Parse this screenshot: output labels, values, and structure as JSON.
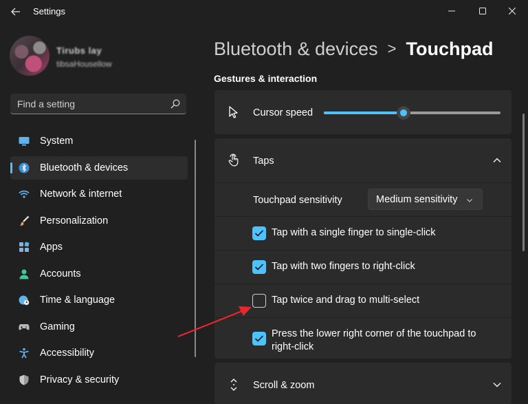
{
  "window": {
    "title": "Settings",
    "back_icon": "back-arrow-icon",
    "controls": [
      "minimize-icon",
      "maximize-icon",
      "close-icon"
    ]
  },
  "user": {
    "name": "Tirubs lay",
    "email": "tibsaHousellow"
  },
  "search": {
    "placeholder": "Find a setting",
    "icon": "search-icon"
  },
  "sidebar": {
    "items": [
      {
        "label": "System",
        "icon": "system-monitor-icon",
        "selected": false
      },
      {
        "label": "Bluetooth & devices",
        "icon": "bluetooth-icon",
        "selected": true
      },
      {
        "label": "Network & internet",
        "icon": "wifi-icon",
        "selected": false
      },
      {
        "label": "Personalization",
        "icon": "paintbrush-icon",
        "selected": false
      },
      {
        "label": "Apps",
        "icon": "apps-grid-icon",
        "selected": false
      },
      {
        "label": "Accounts",
        "icon": "person-icon",
        "selected": false
      },
      {
        "label": "Time & language",
        "icon": "globe-clock-icon",
        "selected": false
      },
      {
        "label": "Gaming",
        "icon": "gamepad-icon",
        "selected": false
      },
      {
        "label": "Accessibility",
        "icon": "accessibility-icon",
        "selected": false
      },
      {
        "label": "Privacy & security",
        "icon": "shield-icon",
        "selected": false
      }
    ]
  },
  "breadcrumb": {
    "parent": "Bluetooth & devices",
    "separator": ">",
    "current": "Touchpad"
  },
  "section": {
    "title": "Gestures & interaction"
  },
  "cursor_speed": {
    "label": "Cursor speed",
    "icon": "cursor-arrow-icon",
    "value_fraction": 0.45
  },
  "taps": {
    "label": "Taps",
    "icon": "touch-hand-icon",
    "expanded": true,
    "sensitivity": {
      "label": "Touchpad sensitivity",
      "value": "Medium sensitivity"
    },
    "options": [
      {
        "label": "Tap with a single finger to single-click",
        "checked": true
      },
      {
        "label": "Tap with two fingers to right-click",
        "checked": true
      },
      {
        "label": "Tap twice and drag to multi-select",
        "checked": false
      },
      {
        "label_line1": "Press the lower right corner of the touchpad to",
        "label_line2": "right-click",
        "checked": true
      }
    ]
  },
  "scroll_zoom": {
    "label": "Scroll & zoom",
    "icon": "scroll-arrows-icon",
    "expanded": false
  },
  "colors": {
    "accent": "#4cc2ff",
    "background": "#202020",
    "card": "#2b2b2b",
    "annotation_arrow": "#e8262b"
  }
}
